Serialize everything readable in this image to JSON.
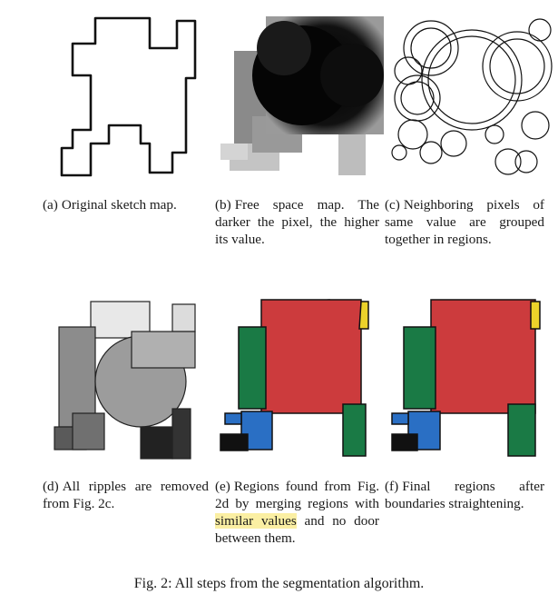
{
  "figure": {
    "caption": "Fig. 2: All steps from the segmentation algorithm."
  },
  "panels": {
    "a": {
      "label": "(a)",
      "text": "Original sketch map."
    },
    "b": {
      "label": "(b)",
      "text": "Free space map. The darker the pixel, the higher its value."
    },
    "c": {
      "label": "(c)",
      "text": "Neighboring pixels of same value are grouped together in regions."
    },
    "d": {
      "label": "(d)",
      "text": "All ripples are removed from Fig. 2c."
    },
    "e": {
      "label": "(e)",
      "text_before": "Regions found from Fig. 2d by merging regions with ",
      "highlight": "similar values",
      "text_after": " and no door between them."
    },
    "f": {
      "label": "(f)",
      "text": "Final regions after boundaries straightening."
    }
  },
  "colors": {
    "region_red": "#cc3b3d",
    "region_green": "#1a7a45",
    "region_blue": "#2a6fc4",
    "region_yellow": "#ecd32a",
    "highlight": "#fbefa3"
  }
}
